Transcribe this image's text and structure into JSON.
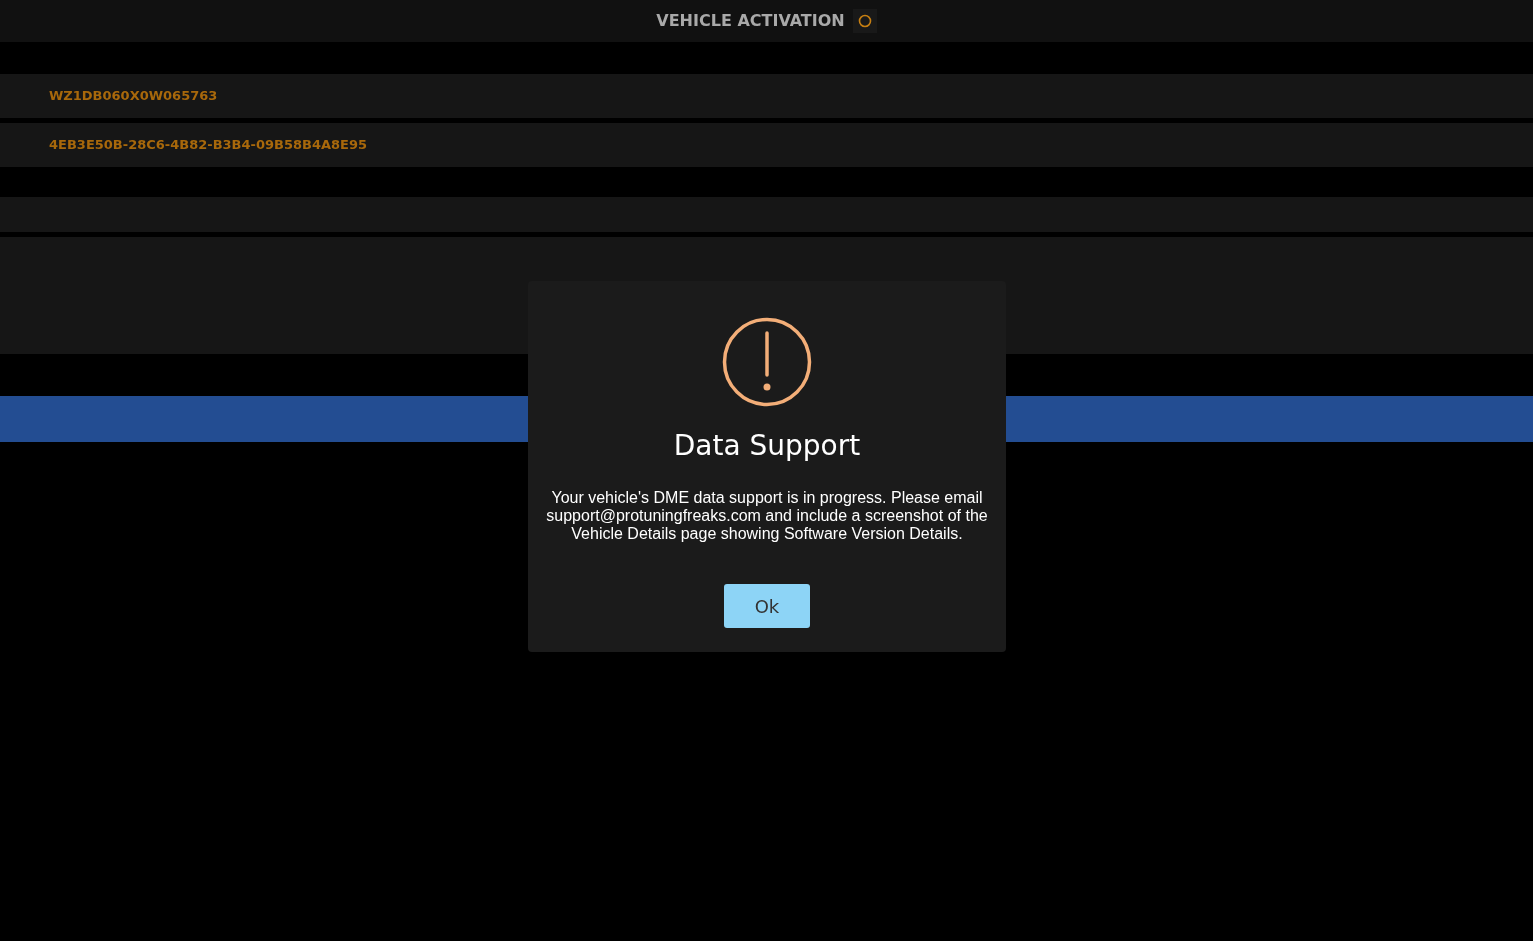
{
  "header": {
    "title": "VEHICLE ACTIVATION"
  },
  "fields": [
    {
      "value": "WZ1DB060X0W065763"
    },
    {
      "value": "4EB3E50B-28C6-4B82-B3B4-09B58B4A8E95"
    }
  ],
  "dialog": {
    "title": "Data Support",
    "message": "Your vehicle's DME data support is in progress. Please email support@protuningfreaks.com and include a screenshot of the Vehicle Details page showing Software Version Details.",
    "button": "Ok"
  }
}
